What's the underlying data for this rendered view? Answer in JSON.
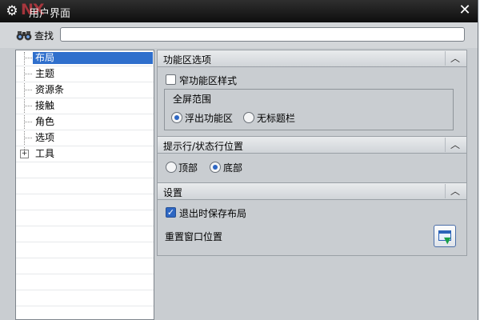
{
  "window": {
    "title": "用户界面",
    "watermark_logo": "NX",
    "close_glyph": "✕"
  },
  "find": {
    "label": "查找",
    "value": "",
    "placeholder": ""
  },
  "tree": {
    "items": [
      {
        "label": "布局",
        "selected": true
      },
      {
        "label": "主题",
        "selected": false
      },
      {
        "label": "资源条",
        "selected": false
      },
      {
        "label": "接触",
        "selected": false
      },
      {
        "label": "角色",
        "selected": false
      },
      {
        "label": "选项",
        "selected": false
      },
      {
        "label": "工具",
        "selected": false,
        "expandable": true
      }
    ],
    "expander_glyph": "+"
  },
  "sections": {
    "ribbon": {
      "title": "功能区选项",
      "collapse_glyph": "︿",
      "narrow_style_label": "窄功能区样式",
      "narrow_style_checked": false,
      "fullscreen_group_title": "全屏范围",
      "float_ribbon_label": "浮出功能区",
      "float_ribbon_selected": true,
      "no_titlebar_label": "无标题栏",
      "no_titlebar_selected": false
    },
    "prompt": {
      "title": "提示行/状态行位置",
      "collapse_glyph": "︿",
      "top_label": "顶部",
      "top_selected": false,
      "bottom_label": "底部",
      "bottom_selected": true
    },
    "settings": {
      "title": "设置",
      "collapse_glyph": "︿",
      "save_on_exit_label": "退出时保存布局",
      "save_on_exit_checked": true,
      "reset_window_label": "重置窗口位置"
    }
  },
  "colors": {
    "selection": "#2f6fcc",
    "titlebar": "#1a1a1a",
    "panel": "#c9cdd1"
  },
  "icons": {
    "app": "gear-icon",
    "find": "binoculars-icon",
    "reset": "window-reset-icon"
  }
}
